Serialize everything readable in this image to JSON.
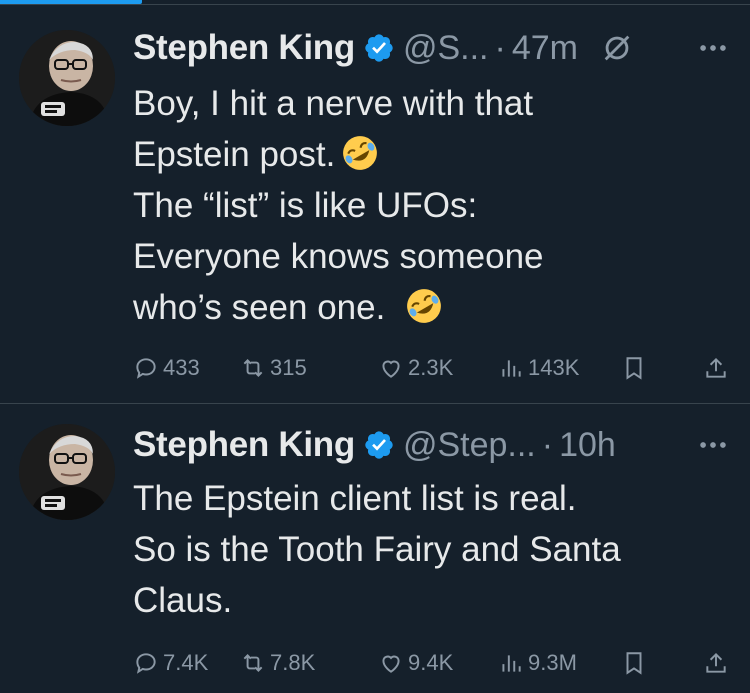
{
  "tweets": [
    {
      "author": "Stephen King",
      "handle": "@S...",
      "separator": "·",
      "time": "47m",
      "text_lines": [
        "Boy, I hit a nerve with that",
        "Epstein post.",
        "The “list” is like UFOs:",
        "Everyone knows someone",
        "who’s seen one."
      ],
      "stats": {
        "replies": "433",
        "reposts": "315",
        "likes": "2.3K",
        "views": "143K"
      }
    },
    {
      "author": "Stephen King",
      "handle": "@Step...",
      "separator": "·",
      "time": "10h",
      "text_lines": [
        "The Epstein client list is real.",
        "So is the Tooth Fairy and Santa",
        "Claus."
      ],
      "stats": {
        "replies": "7.4K",
        "reposts": "7.8K",
        "likes": "9.4K",
        "views": "9.3M"
      }
    }
  ],
  "icons": {
    "verified": "verified-badge-icon",
    "grok": "grok-icon",
    "more": "more-icon",
    "reply": "reply-icon",
    "repost": "repost-icon",
    "like": "like-icon",
    "views": "views-icon",
    "bookmark": "bookmark-icon",
    "share": "share-icon",
    "emoji": "rolling-on-floor-laughing-emoji"
  },
  "colors": {
    "background": "#15202b",
    "text": "#e7e9ea",
    "secondary": "#8b98a5",
    "accent": "#1d9bf0",
    "divider": "#38444d"
  }
}
